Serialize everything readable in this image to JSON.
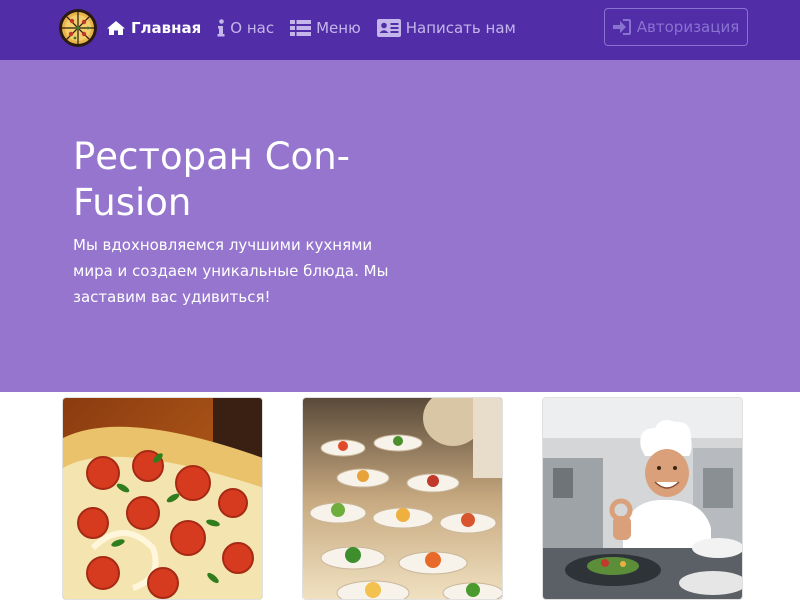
{
  "navbar": {
    "logo_icon": "pizza-logo-icon",
    "items": [
      {
        "label": "Главная",
        "icon": "home-icon",
        "active": true
      },
      {
        "label": "О нас",
        "icon": "info-icon",
        "active": false
      },
      {
        "label": "Меню",
        "icon": "list-icon",
        "active": false
      },
      {
        "label": "Написать нам",
        "icon": "address-card-icon",
        "active": false
      }
    ],
    "login_label": "Авторизация",
    "login_icon": "sign-in-icon"
  },
  "jumbotron": {
    "title": "Ресторан Con-Fusion",
    "text": "Мы вдохновляемся лучшими кухнями мира и создаем уникальные блюда. Мы заставим вас удивиться!"
  },
  "cards": [
    {
      "image": "pizza-photo"
    },
    {
      "image": "buffet-photo"
    },
    {
      "image": "chef-photo"
    }
  ],
  "colors": {
    "navbar_bg": "#512da8",
    "jumbotron_bg": "#9575cd",
    "text_light": "#ffffff",
    "nav_inactive": "#c4b5ea",
    "login_border": "#8a72d1"
  }
}
